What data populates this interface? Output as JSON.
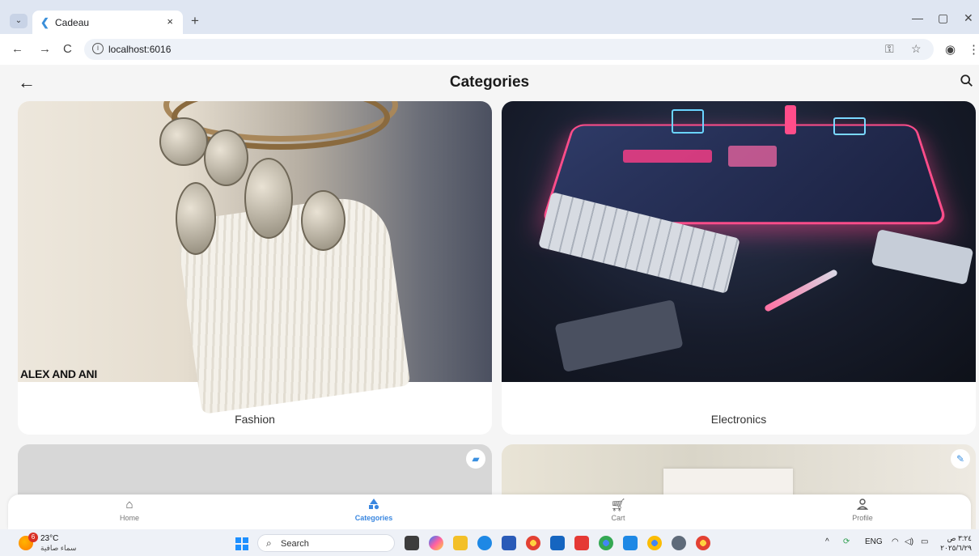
{
  "browser": {
    "tab_title": "Cadeau",
    "tab_close": "×",
    "new_tab": "+",
    "tab_menu": "⌄",
    "window_controls": {
      "minimize": "—",
      "restore": "▢",
      "close": "✕"
    },
    "nav": {
      "back": "←",
      "forward": "→",
      "reload": "C"
    },
    "url": "localhost:6016",
    "info_icon": "i",
    "right_icons": [
      "key-icon",
      "star-icon",
      "profile-icon",
      "menu-icon"
    ]
  },
  "app": {
    "title": "Categories",
    "back": "←",
    "categories": [
      {
        "label": "Fashion",
        "image_text": "ALEX AND ANI"
      },
      {
        "label": "Electronics"
      }
    ],
    "lower_cards_badges": [
      "car-icon",
      "pencil-icon"
    ]
  },
  "bottom_nav": {
    "items": [
      {
        "label": "Home",
        "icon": "home-icon"
      },
      {
        "label": "Categories",
        "icon": "categories-icon",
        "active": true
      },
      {
        "label": "Cart",
        "icon": "cart-icon"
      },
      {
        "label": "Profile",
        "icon": "profile-icon"
      }
    ],
    "accent": "#3a87e0"
  },
  "taskbar": {
    "weather_badge": "6",
    "temperature": "23°C",
    "weather_desc": "سماء صافية",
    "search_placeholder": "Search",
    "language": "ENG",
    "time": "٣:٢٤ ص",
    "date": "٢٠٢٥/٦/٢٩"
  }
}
